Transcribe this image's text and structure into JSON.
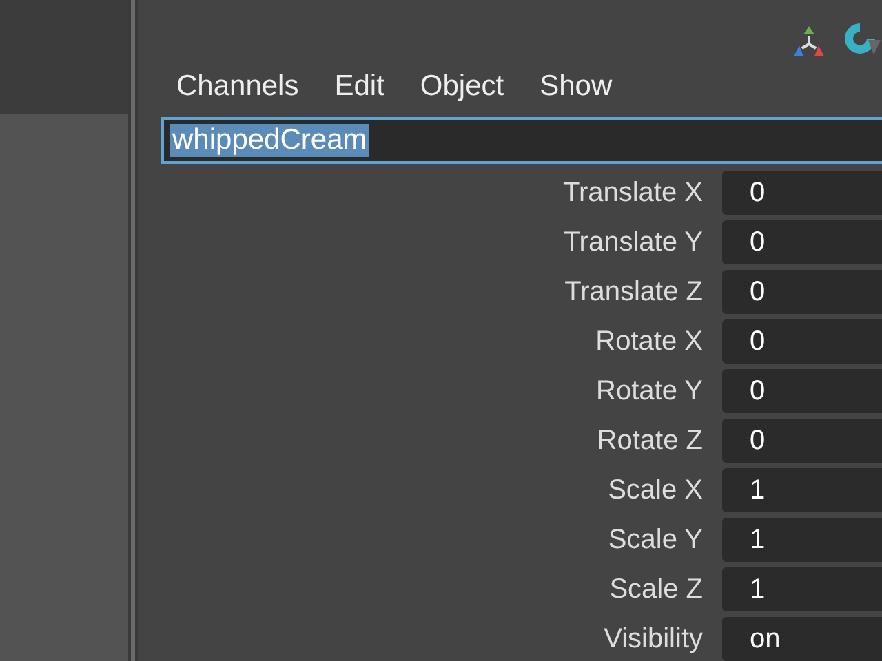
{
  "menu": [
    {
      "label": "Channels"
    },
    {
      "label": "Edit"
    },
    {
      "label": "Object"
    },
    {
      "label": "Show"
    }
  ],
  "object_name": {
    "value": "whippedCream",
    "selected": true
  },
  "channels": [
    {
      "name": "Translate X",
      "value": "0"
    },
    {
      "name": "Translate Y",
      "value": "0"
    },
    {
      "name": "Translate Z",
      "value": "0"
    },
    {
      "name": "Rotate X",
      "value": "0"
    },
    {
      "name": "Rotate Y",
      "value": "0"
    },
    {
      "name": "Rotate Z",
      "value": "0"
    },
    {
      "name": "Scale X",
      "value": "1"
    },
    {
      "name": "Scale Y",
      "value": "1"
    },
    {
      "name": "Scale Z",
      "value": "1"
    },
    {
      "name": "Visibility",
      "value": "on"
    }
  ]
}
